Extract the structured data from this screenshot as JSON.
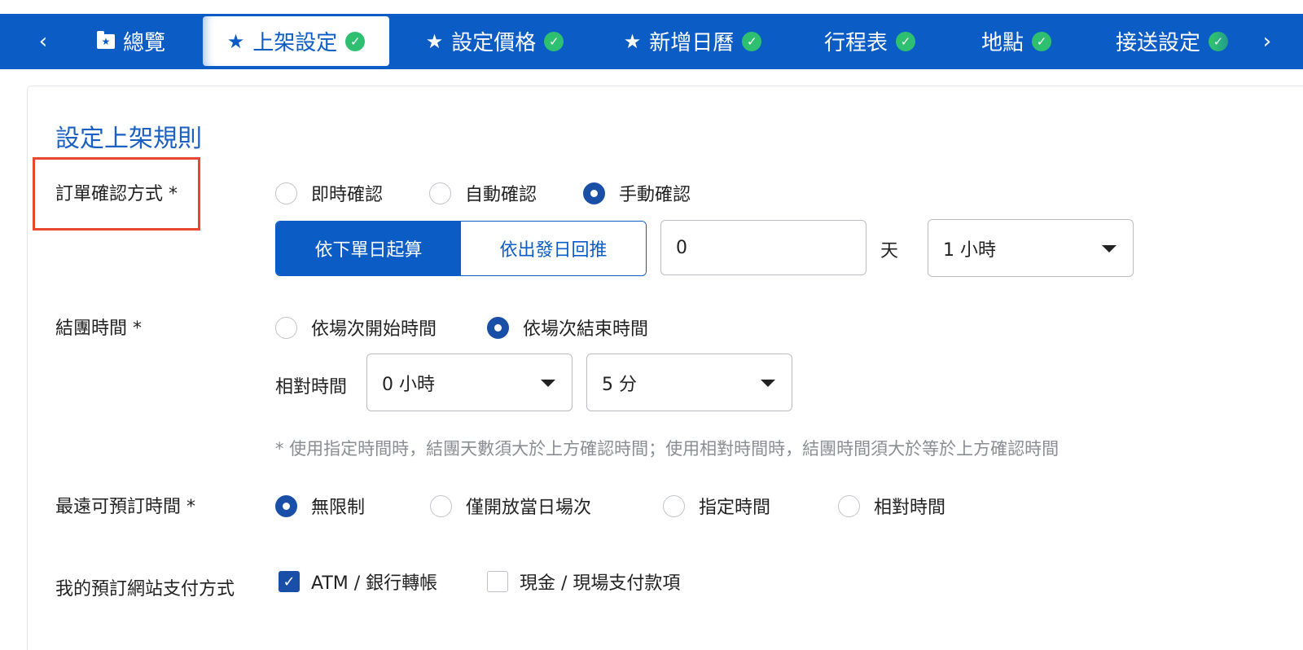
{
  "tabs": {
    "prev": "‹",
    "next": "›",
    "items": [
      {
        "label": "總覽",
        "icon": "folder-star-icon",
        "check": ""
      },
      {
        "label": "上架設定",
        "icon": "star-icon",
        "check": "✓",
        "active": true
      },
      {
        "label": "設定價格",
        "icon": "star-icon",
        "check": "✓"
      },
      {
        "label": "新增日曆",
        "icon": "star-icon",
        "check": "✓"
      },
      {
        "label": "行程表",
        "check": "✓"
      },
      {
        "label": "地點",
        "check": "✓"
      },
      {
        "label": "接送設定",
        "check": "✓"
      }
    ],
    "star_glyph": "★",
    "folder_glyph": "★"
  },
  "section_title": "設定上架規則",
  "order_confirm": {
    "label": "訂單確認方式 *",
    "options": [
      "即時確認",
      "自動確認",
      "手動確認"
    ],
    "selected": "手動確認",
    "segments": [
      "依下單日起算",
      "依出發日回推"
    ],
    "segment_selected": "依下單日起算",
    "days_value": "0",
    "days_unit": "天",
    "hour_select": "1 小時"
  },
  "close_time": {
    "label": "結團時間 *",
    "options": [
      "依場次開始時間",
      "依場次結束時間"
    ],
    "selected": "依場次結束時間",
    "relative_label": "相對時間",
    "hour_select": "0 小時",
    "minute_select": "5 分",
    "hint": "* 使用指定時間時，結團天數須大於上方確認時間；使用相對時間時，結團時間須大於等於上方確認時間"
  },
  "furthest_booking": {
    "label": "最遠可預訂時間 *",
    "options": [
      "無限制",
      "僅開放當日場次",
      "指定時間",
      "相對時間"
    ],
    "selected": "無限制"
  },
  "payment": {
    "label": "我的預訂網站支付方式",
    "options": [
      {
        "label": "ATM / 銀行轉帳",
        "checked": true,
        "mark": "✓"
      },
      {
        "label": "現金 / 現場支付款項",
        "checked": false,
        "mark": ""
      }
    ]
  },
  "colors": {
    "brand_blue": "#0b5cc4",
    "radio_blue": "#1a4fa8",
    "check_green": "#2fbf71",
    "highlight_red": "#e8482e"
  }
}
